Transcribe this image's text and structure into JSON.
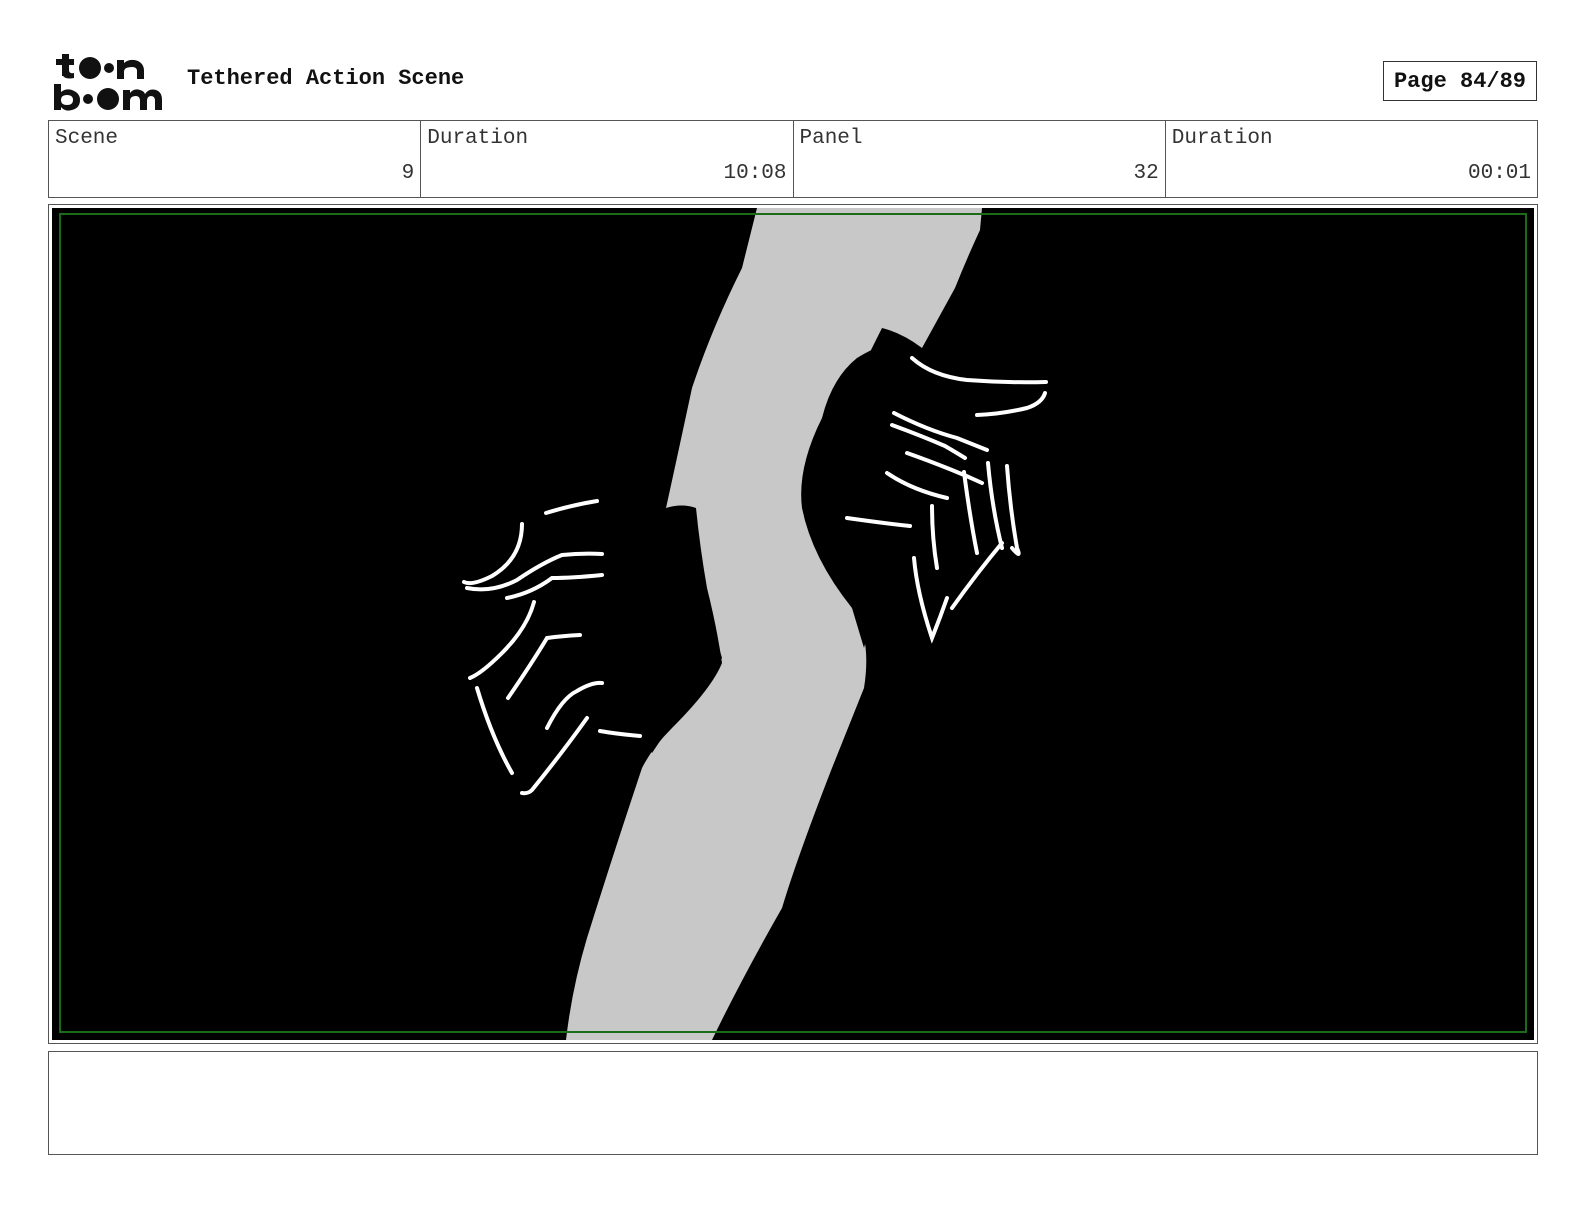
{
  "header": {
    "logo_icon": "toonboom-logo",
    "logo_text": "toon boom",
    "title": "Tethered Action Scene",
    "page_label": "Page 84/89"
  },
  "info": {
    "scene_label": "Scene",
    "scene_value": "9",
    "scene_duration_label": "Duration",
    "scene_duration_value": "10:08",
    "panel_label": "Panel",
    "panel_value": "32",
    "panel_duration_label": "Duration",
    "panel_duration_value": "00:01"
  },
  "panel": {
    "image_icon": "storyboard-drawing",
    "background_color": "#000000",
    "rope_color": "#c8c8c8",
    "safe_frame_color": "#1a6b1a",
    "line_color": "#ffffff"
  },
  "notes": {
    "text": ""
  }
}
